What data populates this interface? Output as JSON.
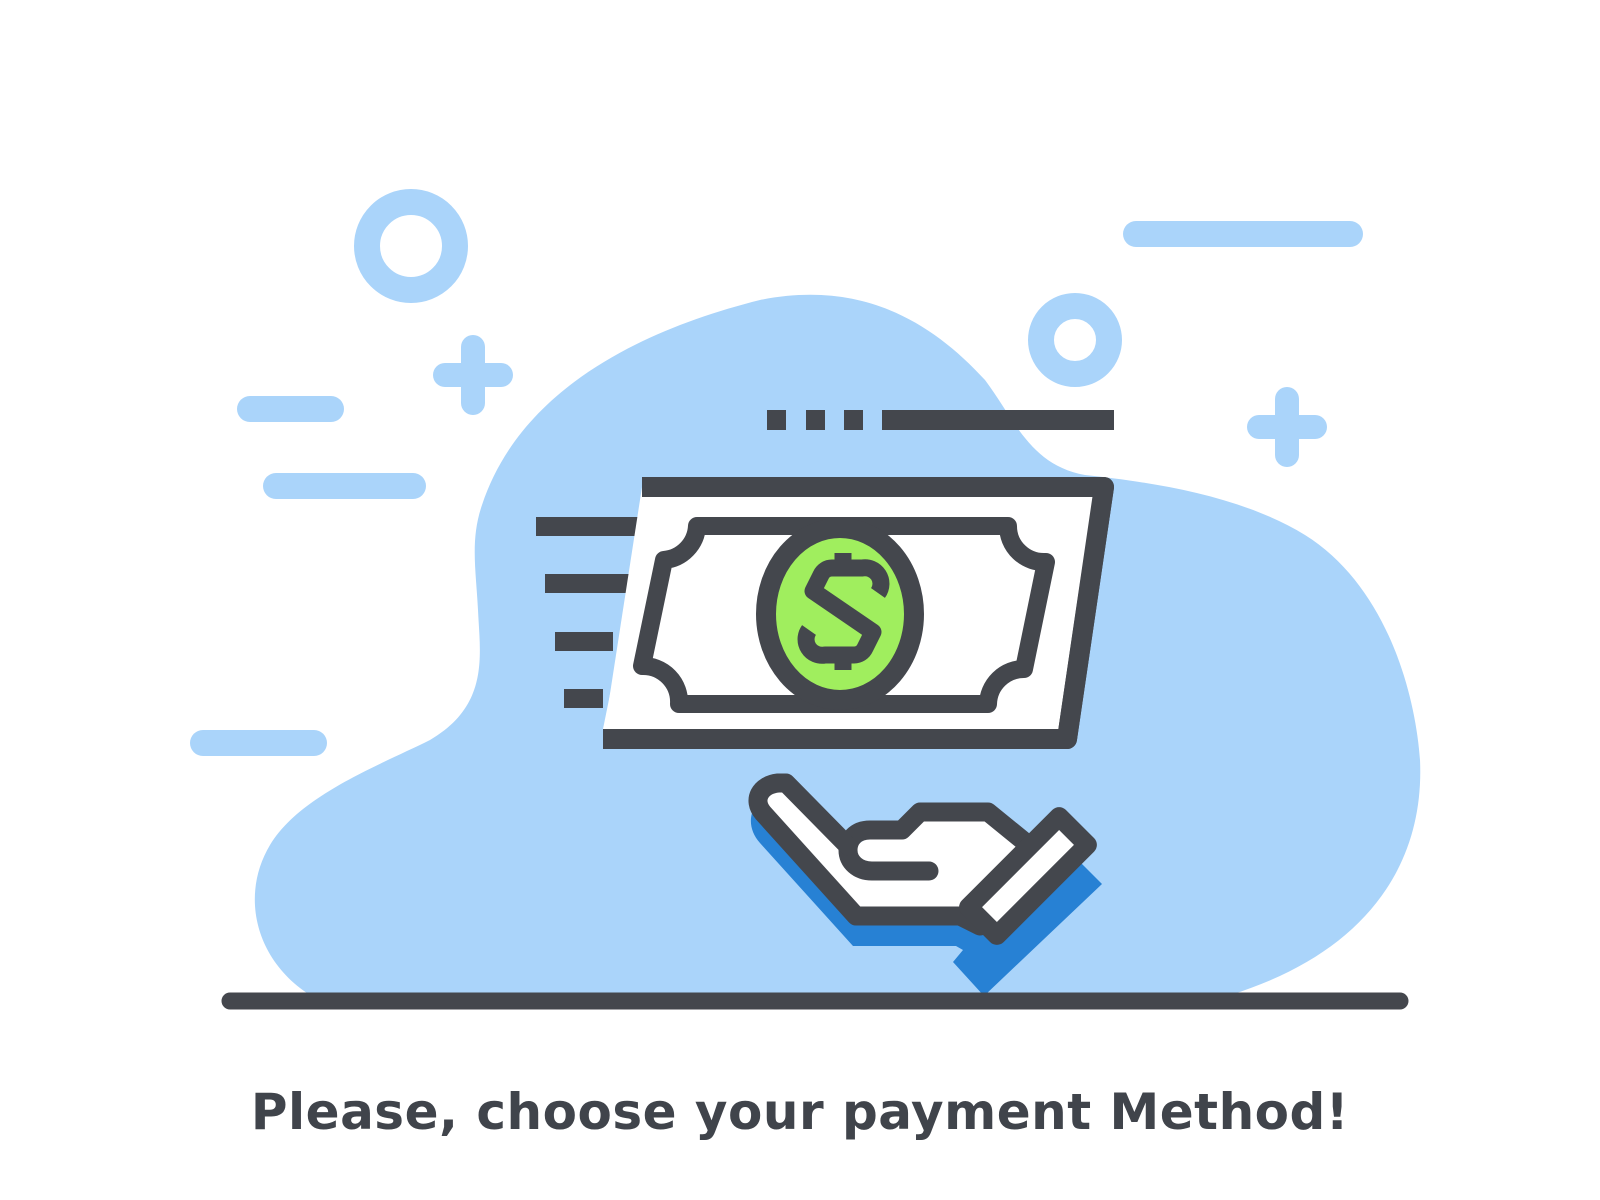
{
  "message": {
    "text": "Please, choose your payment Method!"
  },
  "illustration": {
    "icons": [
      "payment-bill-icon",
      "dollar-sign-icon",
      "hand-icon",
      "plus-icon",
      "ring-icon"
    ],
    "colors": {
      "blob": "#aad4fa",
      "outline": "#44474d",
      "coin": "#a0ee5e",
      "hand_shadow": "#2781d4",
      "decoration": "#aad4fa"
    }
  }
}
